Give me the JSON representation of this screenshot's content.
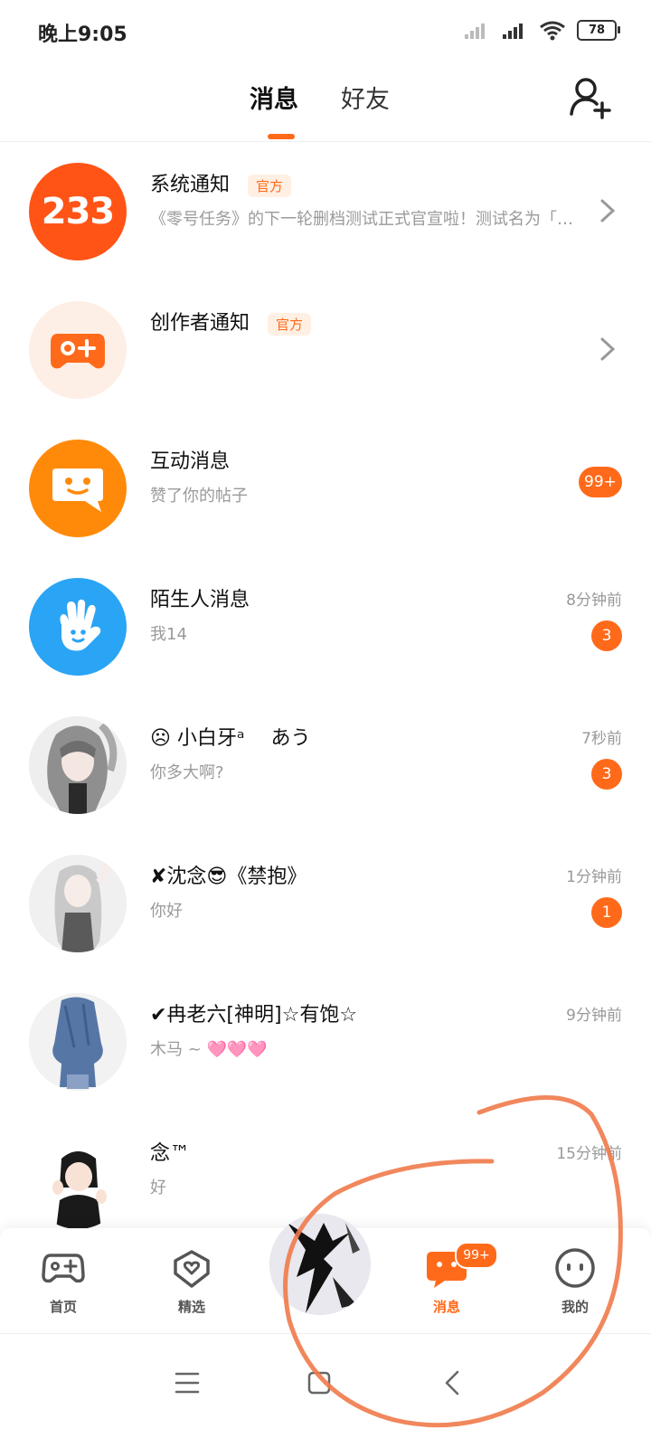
{
  "status_bar": {
    "time": "晚上9:05",
    "battery": "78"
  },
  "header": {
    "tabs": [
      {
        "label": "消息"
      },
      {
        "label": "好友"
      }
    ]
  },
  "messages": [
    {
      "name": "系统通知",
      "tag": "官方",
      "preview": "《零号任务》的下一轮删档测试正式官宣啦！测试名为「…",
      "avatar_text": "233"
    },
    {
      "name": "创作者通知",
      "tag": "官方",
      "preview": ""
    },
    {
      "name": "互动消息",
      "preview": "赞了你的帖子",
      "badge": "99+"
    },
    {
      "name": "陌生人消息",
      "preview": "我14",
      "time": "8分钟前",
      "badge": "3"
    },
    {
      "name": "☹ 小白牙ᵃ　 あう",
      "preview": "你多大啊?",
      "time": "7秒前",
      "badge": "3"
    },
    {
      "name": "✘沈念😎《禁抱》",
      "preview": "你好",
      "time": "1分钟前",
      "badge": "1"
    },
    {
      "name": "✔冉老六[神明]☆有饱☆",
      "preview": "木马 ~ 🩷🩷🩷",
      "time": "9分钟前"
    },
    {
      "name": "念™",
      "preview": "好",
      "time": "15分钟前"
    }
  ],
  "bottom_nav": {
    "items": [
      {
        "label": "首页"
      },
      {
        "label": "精选"
      },
      {
        "label": "消息"
      },
      {
        "label": "我的"
      }
    ],
    "message_badge": "99+"
  },
  "colors": {
    "accent": "#ff6a1a",
    "interaction": "#ff8a0a",
    "stranger": "#2aa4f4"
  }
}
